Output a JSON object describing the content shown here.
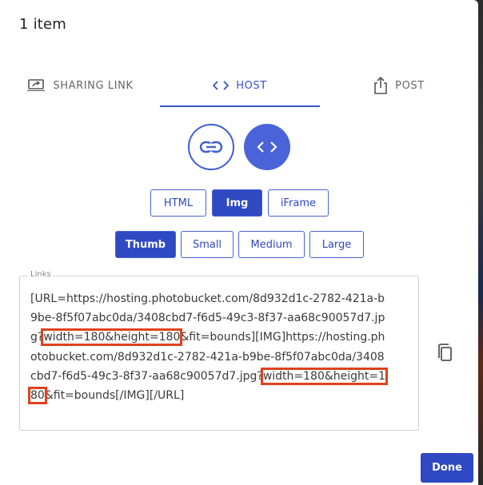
{
  "dialog": {
    "title": "1 item"
  },
  "tabs": [
    {
      "label": "SHARING LINK",
      "icon": "laptop-share-icon",
      "active": false
    },
    {
      "label": "HOST",
      "icon": "code-icon",
      "active": true
    },
    {
      "label": "POST",
      "icon": "share-upload-icon",
      "active": false
    }
  ],
  "mode_buttons": [
    {
      "icon": "link-icon",
      "selected": false
    },
    {
      "icon": "code-icon",
      "selected": true
    }
  ],
  "format_options": [
    {
      "label": "HTML",
      "selected": false
    },
    {
      "label": "Img",
      "selected": true
    },
    {
      "label": "iFrame",
      "selected": false
    }
  ],
  "size_options": [
    {
      "label": "Thumb",
      "selected": true
    },
    {
      "label": "Small",
      "selected": false
    },
    {
      "label": "Medium",
      "selected": false
    },
    {
      "label": "Large",
      "selected": false
    }
  ],
  "links": {
    "legend": "Links",
    "seg1": "[URL=https://hosting.photobucket.com/8d932d1c-2782-421a-b9be-8f5f07abc0da/3408cbd7-f6d5-49c3-8f37-aa68c90057d7.jpg?",
    "highlight1": "width=180&height=180",
    "seg2": "&fit=bounds][IMG]https://hosting.photobucket.com/8d932d1c-2782-421a-b9be-8f5f07abc0da/3408cbd7-f6d5-49c3-8f37-aa68c90057d7.jpg?",
    "highlight2": "width=180&height=180",
    "seg3": "&fit=bounds[/IMG][/URL]",
    "highlight_color": "#e0421e"
  },
  "actions": {
    "copy_icon": "copy-icon",
    "done_label": "Done"
  },
  "colors": {
    "accent": "#2f49c2"
  }
}
